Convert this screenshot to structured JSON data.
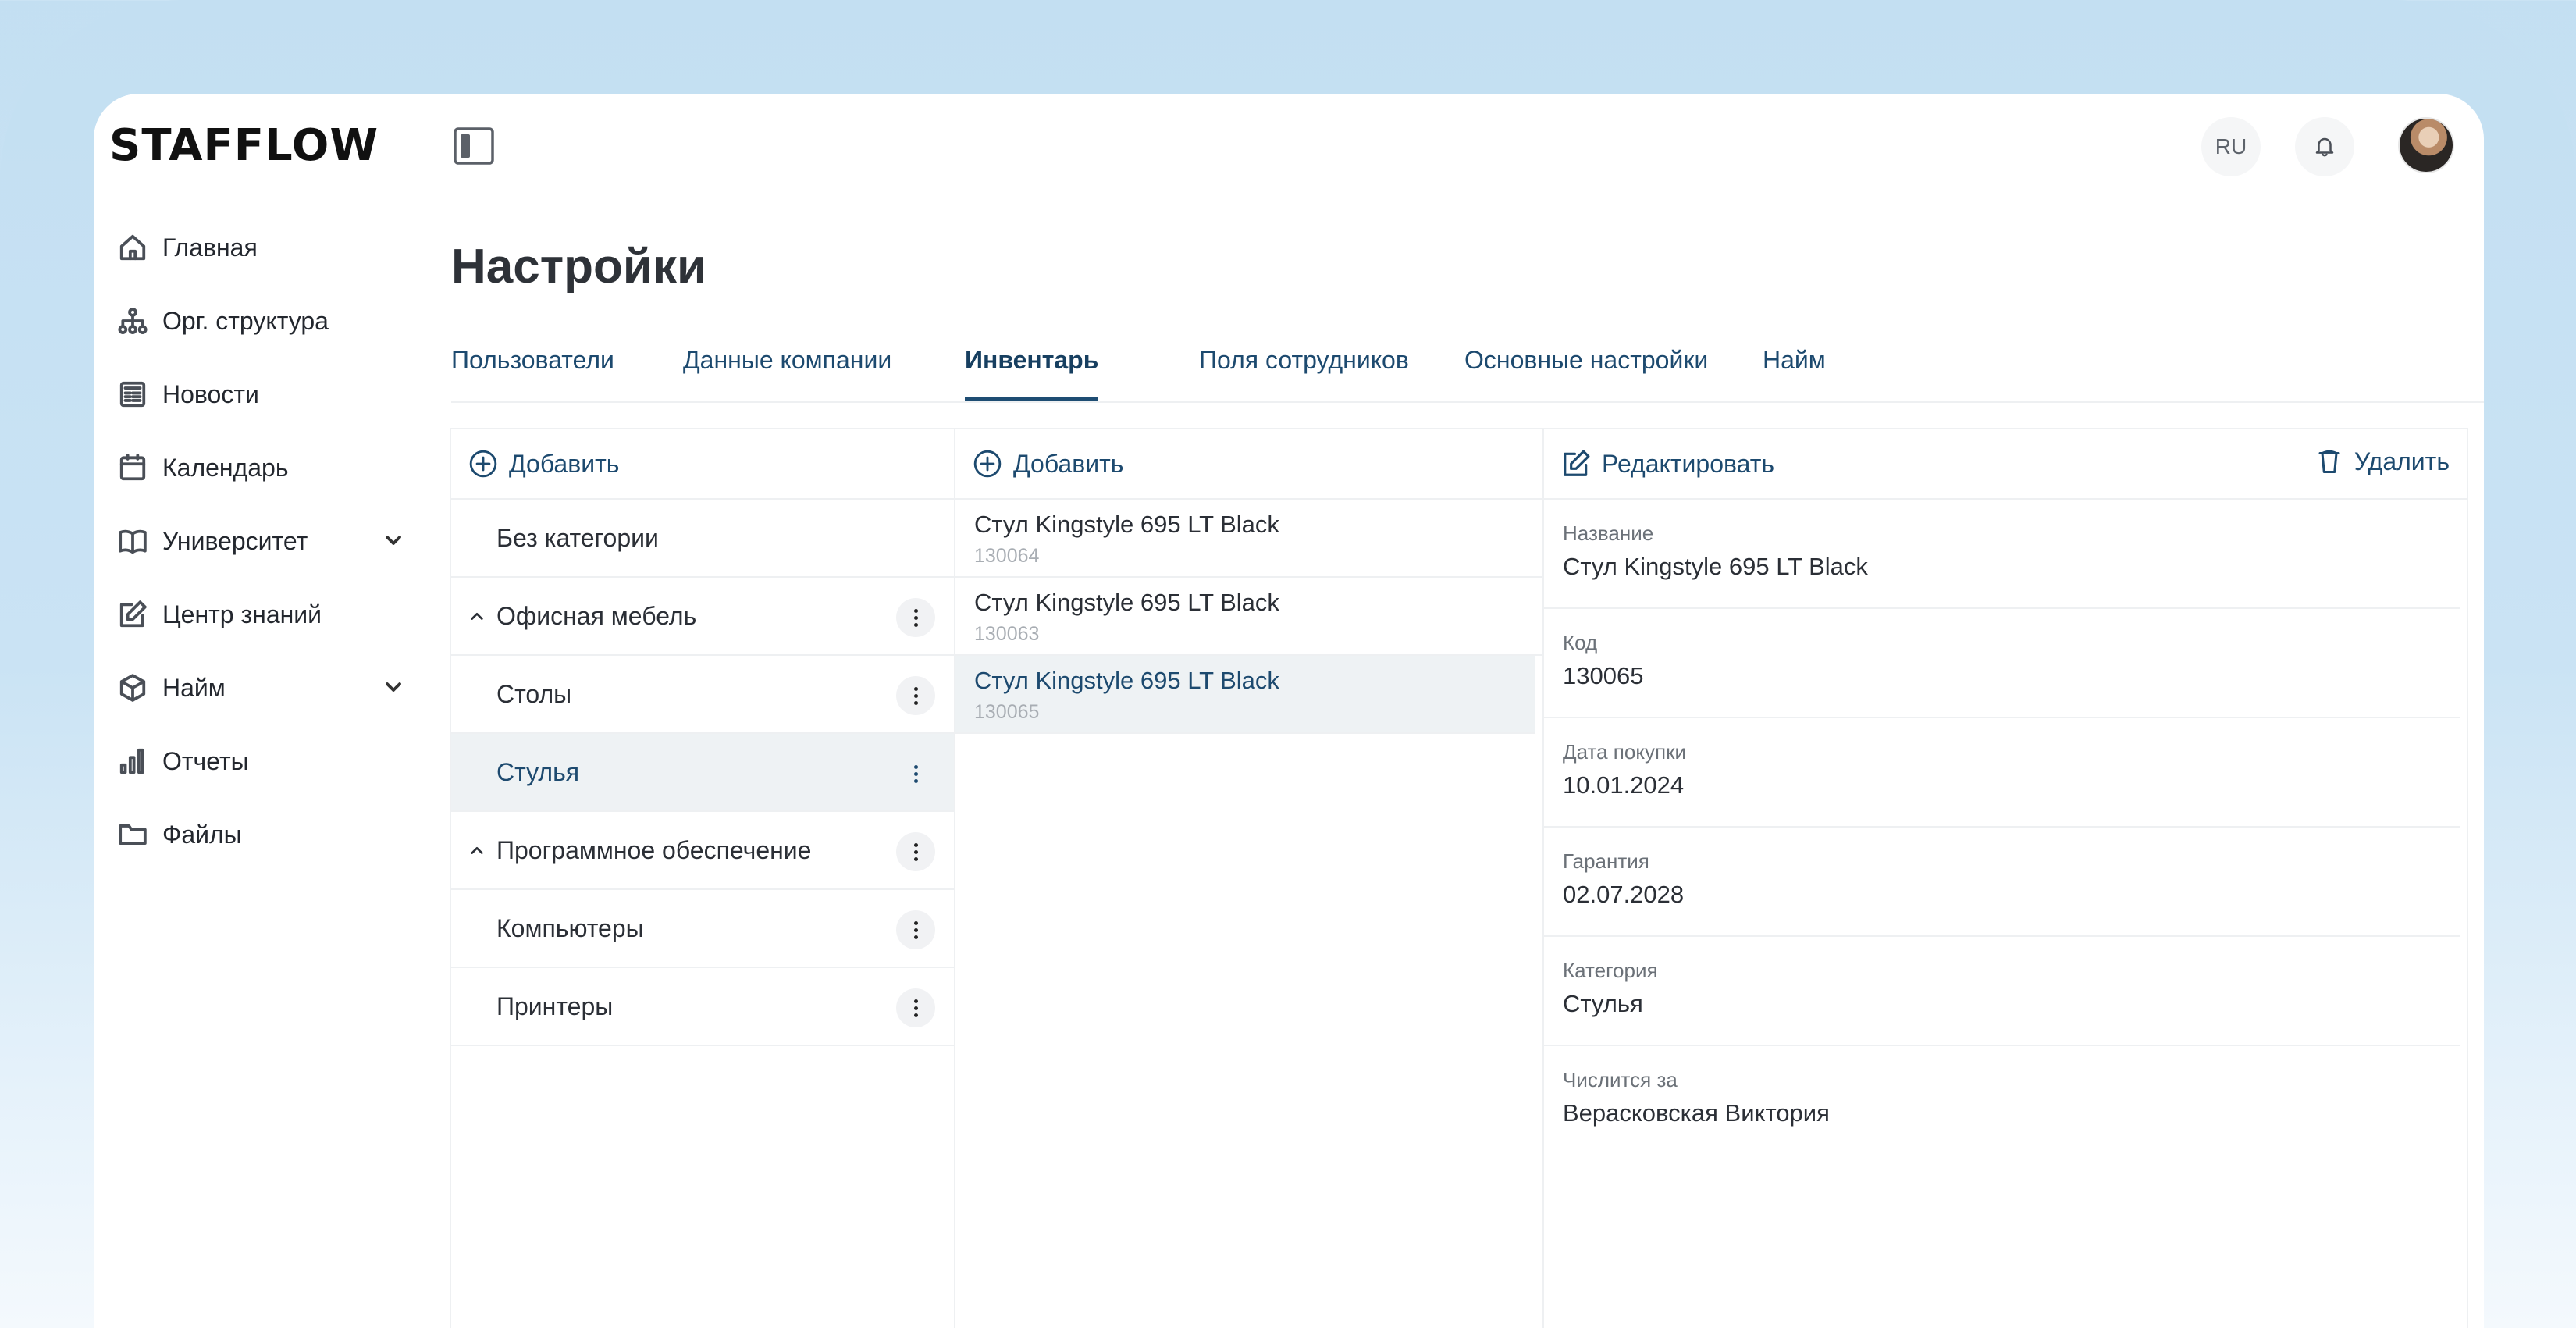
{
  "app": {
    "logo": "STAFFLOW"
  },
  "sidebar": {
    "items": [
      {
        "label": "Главная",
        "icon": "home-icon"
      },
      {
        "label": "Орг. структура",
        "icon": "org-structure-icon"
      },
      {
        "label": "Новости",
        "icon": "news-icon"
      },
      {
        "label": "Календарь",
        "icon": "calendar-icon"
      },
      {
        "label": "Университет",
        "icon": "book-icon",
        "expandable": true
      },
      {
        "label": "Центр знаний",
        "icon": "edit-icon"
      },
      {
        "label": "Найм",
        "icon": "cube-icon",
        "expandable": true
      },
      {
        "label": "Отчеты",
        "icon": "bar-chart-icon"
      },
      {
        "label": "Файлы",
        "icon": "folder-icon"
      }
    ]
  },
  "header": {
    "language": "RU"
  },
  "page": {
    "title": "Настройки"
  },
  "tabs": [
    {
      "label": "Пользователи",
      "active": false
    },
    {
      "label": "Данные компании",
      "active": false
    },
    {
      "label": "Инвентарь",
      "active": true
    },
    {
      "label": "Поля сотрудников",
      "active": false
    },
    {
      "label": "Основные настройки",
      "active": false
    },
    {
      "label": "Найм",
      "active": false
    }
  ],
  "categories_panel": {
    "add_label": "Добавить",
    "rows": [
      {
        "label": "Без категории",
        "expandable": false,
        "has_menu": false,
        "selected": false
      },
      {
        "label": "Офисная мебель",
        "expandable": true,
        "has_menu": true,
        "selected": false
      },
      {
        "label": "Столы",
        "expandable": false,
        "has_menu": true,
        "selected": false
      },
      {
        "label": "Стулья",
        "expandable": false,
        "has_menu": true,
        "selected": true
      },
      {
        "label": "Программное обеспечение",
        "expandable": true,
        "has_menu": true,
        "selected": false
      },
      {
        "label": "Компьютеры",
        "expandable": false,
        "has_menu": true,
        "selected": false
      },
      {
        "label": "Принтеры",
        "expandable": false,
        "has_menu": true,
        "selected": false
      }
    ]
  },
  "items_panel": {
    "add_label": "Добавить",
    "items": [
      {
        "name": "Стул Kingstyle 695 LT Black",
        "code": "130064",
        "selected": false
      },
      {
        "name": "Стул Kingstyle 695 LT Black",
        "code": "130063",
        "selected": false
      },
      {
        "name": "Стул Kingstyle 695 LT Black",
        "code": "130065",
        "selected": true
      }
    ]
  },
  "details_panel": {
    "edit_label": "Редактировать",
    "delete_label": "Удалить",
    "fields": [
      {
        "label": "Название",
        "value": "Стул Kingstyle 695 LT Black"
      },
      {
        "label": "Код",
        "value": "130065"
      },
      {
        "label": "Дата покупки",
        "value": "10.01.2024"
      },
      {
        "label": "Гарантия",
        "value": "02.07.2028"
      },
      {
        "label": "Категория",
        "value": "Стулья"
      },
      {
        "label": "Числится за",
        "value": "Верасковская Виктория"
      }
    ]
  },
  "colors": {
    "accent": "#1d4a6f",
    "selected_bg": "#eef2f4",
    "border": "#eef0f2"
  }
}
